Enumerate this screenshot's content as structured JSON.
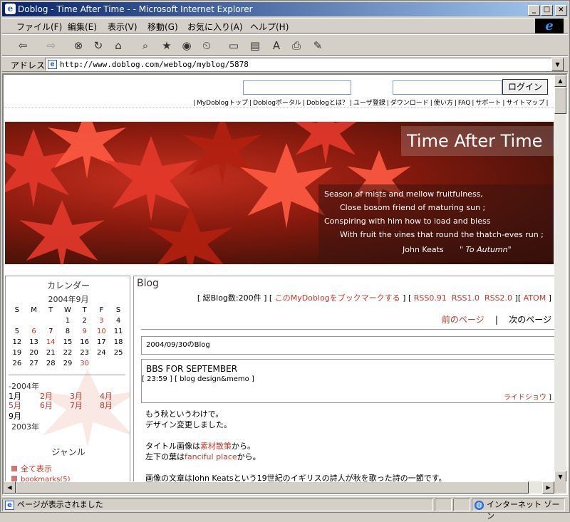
{
  "window": {
    "title": "Doblog - Time After Time - - Microsoft Internet Explorer",
    "icon": "ie-icon",
    "controls": [
      "_",
      "□",
      "×"
    ]
  },
  "menu": {
    "items": [
      "ファイル(F)",
      "編集(E)",
      "表示(V)",
      "移動(G)",
      "お気に入り(A)",
      "ヘルプ(H)"
    ],
    "brand": "e"
  },
  "toolbar": {
    "icons": [
      "back-icon",
      "forward-icon",
      "stop-icon",
      "refresh-icon",
      "home-icon",
      "search-icon",
      "favorites-icon",
      "media-icon",
      "history-icon",
      "fullscreen-icon",
      "channels-icon",
      "font-icon",
      "print-icon",
      "edit-icon"
    ]
  },
  "address": {
    "label": "アドレス",
    "url": "http://www.doblog.com/weblog/myblog/5878"
  },
  "site": {
    "login_label": "ログイン",
    "top_links": [
      "MyDoblogトップ",
      "Doblogポータル",
      "Doblogとは？",
      "ユーザ登録",
      "ダウンロード",
      "使い方",
      "FAQ",
      "サポート",
      "サイトマップ"
    ]
  },
  "banner": {
    "title": "Time After Time",
    "poem": [
      "Season of mists and mellow fruitfulness,",
      "Close bosom friend of maturing sun ;",
      "Conspiring with him how to load and bless",
      "With fruit the vines that round the thatch-eves run ;"
    ],
    "author": "John Keats",
    "work": "\" To Autumn\""
  },
  "sidebar": {
    "calendar_label": "カレンダー",
    "month": "2004年9月",
    "weekdays": [
      "S",
      "M",
      "T",
      "W",
      "T",
      "F",
      "S"
    ],
    "weeks": [
      [
        "",
        "",
        "",
        "1",
        "2",
        "3",
        "4"
      ],
      [
        "5",
        "6",
        "7",
        "8",
        "9",
        "10",
        "11"
      ],
      [
        "12",
        "13",
        "14",
        "15",
        "16",
        "17",
        "18"
      ],
      [
        "19",
        "20",
        "21",
        "22",
        "23",
        "24",
        "25"
      ],
      [
        "26",
        "27",
        "28",
        "29",
        "30",
        "",
        ""
      ]
    ],
    "linked_days": [
      "3",
      "6",
      "9",
      "10",
      "14",
      "30"
    ],
    "year_2004": "-2004年",
    "months": [
      "1月",
      "2月",
      "3月",
      "4月",
      "5月",
      "6月",
      "7月",
      "8月",
      "9月"
    ],
    "year_2003": "2003年",
    "genre_label": "ジャンル",
    "genres": [
      "全て表示",
      "bookmarks(5)"
    ]
  },
  "main": {
    "title": "Blog",
    "meta_prefix": "[ 総Blog数:200件 ] [ ",
    "bookmark_link": "このMyDoblogをブックマークする",
    "meta_mid": " ] [ ",
    "rss": [
      "RSS0.91",
      "RSS1.0",
      "RSS2.0"
    ],
    "meta_sep": "][ ",
    "atom": "ATOM",
    "meta_end": " ]",
    "prev_page": "前のページ",
    "pager_sep": "|",
    "next_page": "次のページ",
    "date_heading": "2004/09/30のBlog",
    "entry_title": "BBS FOR SEPTEMBER",
    "entry_meta": "[ 23:59 ] [ blog design&memo ]",
    "entry_author": "ライドショウ",
    "entry_author_end": " ]",
    "body": {
      "p1a": "もう秋というわけで。",
      "p1b": "デザイン変更しました。",
      "p2a_pre": "タイトル画像は",
      "p2a_link": "素材散策",
      "p2a_post": "から。",
      "p2b_pre": "左下の葉は",
      "p2b_link": "fanciful place",
      "p2b_post": "から。",
      "p3": "画像の文章はJohn Keatsという19世紀のイギリスの詩人が秋を歌った詩の一節です。"
    }
  },
  "status": {
    "text": "ページが表示されました",
    "zone": "インターネット ゾーン"
  },
  "colors": {
    "accent_link": "#c0392b",
    "titlebar_start": "#0a246a",
    "titlebar_end": "#a6caf0"
  }
}
